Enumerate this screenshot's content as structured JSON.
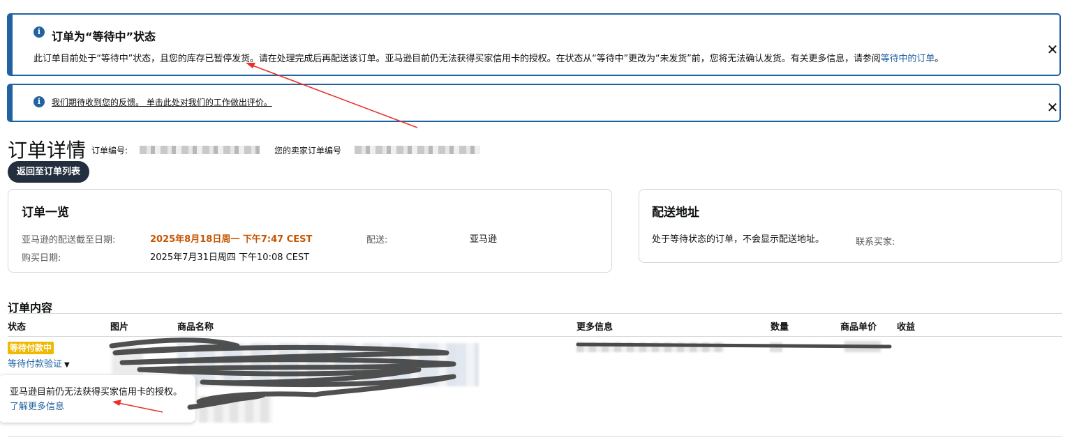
{
  "banner_pending": {
    "title": "订单为“等待中”状态",
    "body": "此订单目前处于“等待中”状态，且您的库存已暂停发货。请在处理完成后再配送该订单。亚马逊目前仍无法获得买家信用卡的授权。在状态从“等待中”更改为“未发货”前，您将无法确认发货。有关更多信息，请参阅",
    "link": "等待中的订单",
    "end": "。",
    "info_icon": "info-icon",
    "close_icon": "close-icon"
  },
  "banner_feedback": {
    "text": "我们期待收到您的反馈。 单击此处对我们的工作做出评价。",
    "info_icon": "info-icon",
    "close_icon": "close-icon"
  },
  "header": {
    "title": "订单详情",
    "order_id_label": "订单编号:",
    "seller_order_id_label": "您的卖家订单编号",
    "back_button": "返回至订单列表"
  },
  "order_summary": {
    "title": "订单一览",
    "ship_by_label": "亚马逊的配送截至日期:",
    "ship_by_value": "2025年8月18日周一 下午7:47 CEST",
    "purchase_date_label": "购买日期:",
    "purchase_date_value": "2025年7月31日周四 下午10:08 CEST",
    "fulfillment_label": "配送:",
    "fulfillment_value": "亚马逊"
  },
  "shipping_address": {
    "title": "配送地址",
    "note": "处于等待状态的订单，不会显示配送地址。",
    "contact_label": "联系买家:"
  },
  "order_contents": {
    "title": "订单内容",
    "columns": [
      "状态",
      "图片",
      "商品名称",
      "更多信息",
      "数量",
      "商品单价",
      "收益"
    ],
    "row": {
      "status_badge": "等待付款中",
      "status_link": "等待付款验证"
    }
  },
  "popover": {
    "text": "亚马逊目前仍无法获得买家信用卡的授权。",
    "link": "了解更多信息"
  },
  "colors": {
    "accent": "#2162a1",
    "ship_by": "#c45500",
    "badge": "#f0b800",
    "button_dark": "#232f3e",
    "annotation": "#e8312a"
  }
}
